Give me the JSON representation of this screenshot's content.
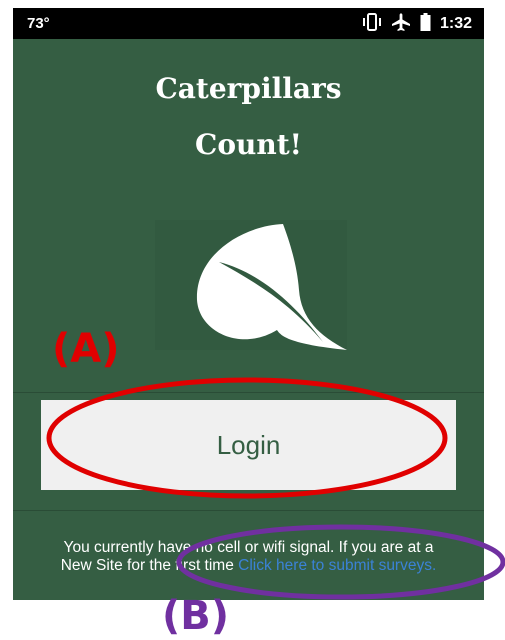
{
  "status_bar": {
    "temperature": "73°",
    "time": "1:32",
    "icons": [
      "vibrate-icon",
      "airplane-icon",
      "battery-icon"
    ]
  },
  "app": {
    "title_line1": "Caterpillars",
    "title_line2": "Count!",
    "logo_icon": "leaf-icon",
    "login_label": "Login",
    "signal_message_line1": "You currently have no cell or wifi signal. If you are at a",
    "signal_message_line2": "New Site for the first time",
    "submit_link": "Click here to submit surveys."
  },
  "annotations": {
    "label_a": "(A)",
    "label_b": "(B)",
    "color_a": "#e00000",
    "color_b": "#7030a0"
  },
  "colors": {
    "background": "#355e43",
    "button": "#f0f0f0",
    "link": "#3b82d6"
  }
}
